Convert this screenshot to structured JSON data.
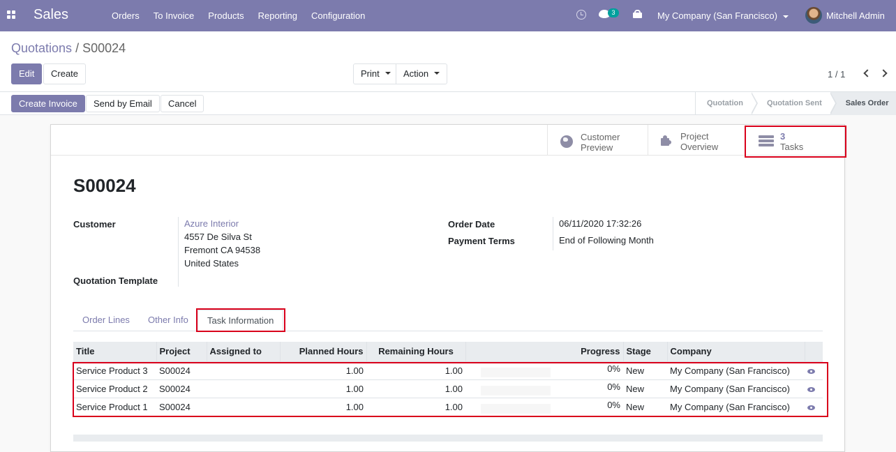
{
  "navbar": {
    "app_name": "Sales",
    "menu": [
      "Orders",
      "To Invoice",
      "Products",
      "Reporting",
      "Configuration"
    ],
    "chat_count": "3",
    "company": "My Company (San Francisco)",
    "user": "Mitchell Admin",
    "accent_color": "#7c7bad"
  },
  "breadcrumb": {
    "parent": "Quotations",
    "separator": " / ",
    "current": "S00024"
  },
  "toolbar": {
    "edit": "Edit",
    "create": "Create",
    "print": "Print",
    "action": "Action",
    "pager": "1 / 1"
  },
  "status_buttons": {
    "create_invoice": "Create Invoice",
    "send_email": "Send by Email",
    "cancel": "Cancel"
  },
  "stages": [
    "Quotation",
    "Quotation Sent",
    "Sales Order"
  ],
  "active_stage": "Sales Order",
  "smart_buttons": {
    "customer_preview": {
      "line1": "Customer",
      "line2": "Preview"
    },
    "project_overview": {
      "line1": "Project",
      "line2": "Overview"
    },
    "tasks": {
      "count": "3",
      "label": "Tasks"
    }
  },
  "record": {
    "name": "S00024",
    "customer_label": "Customer",
    "customer_name": "Azure Interior",
    "address": [
      "4557 De Silva St",
      "Fremont CA 94538",
      "United States"
    ],
    "quotation_template_label": "Quotation Template",
    "order_date_label": "Order Date",
    "order_date": "06/11/2020 17:32:26",
    "payment_terms_label": "Payment Terms",
    "payment_terms": "End of Following Month"
  },
  "tabs": [
    "Order Lines",
    "Other Info",
    "Task Information"
  ],
  "active_tab": "Task Information",
  "tasks_table": {
    "columns": [
      "Title",
      "Project",
      "Assigned to",
      "Planned Hours",
      "Remaining Hours",
      "Progress",
      "Stage",
      "Company"
    ],
    "rows": [
      {
        "title": "Service Product 3",
        "project": "S00024",
        "assigned": "",
        "planned": "1.00",
        "remaining": "1.00",
        "progress": "0%",
        "stage": "New",
        "company": "My Company (San Francisco)"
      },
      {
        "title": "Service Product 2",
        "project": "S00024",
        "assigned": "",
        "planned": "1.00",
        "remaining": "1.00",
        "progress": "0%",
        "stage": "New",
        "company": "My Company (San Francisco)"
      },
      {
        "title": "Service Product 1",
        "project": "S00024",
        "assigned": "",
        "planned": "1.00",
        "remaining": "1.00",
        "progress": "0%",
        "stage": "New",
        "company": "My Company (San Francisco)"
      }
    ]
  }
}
